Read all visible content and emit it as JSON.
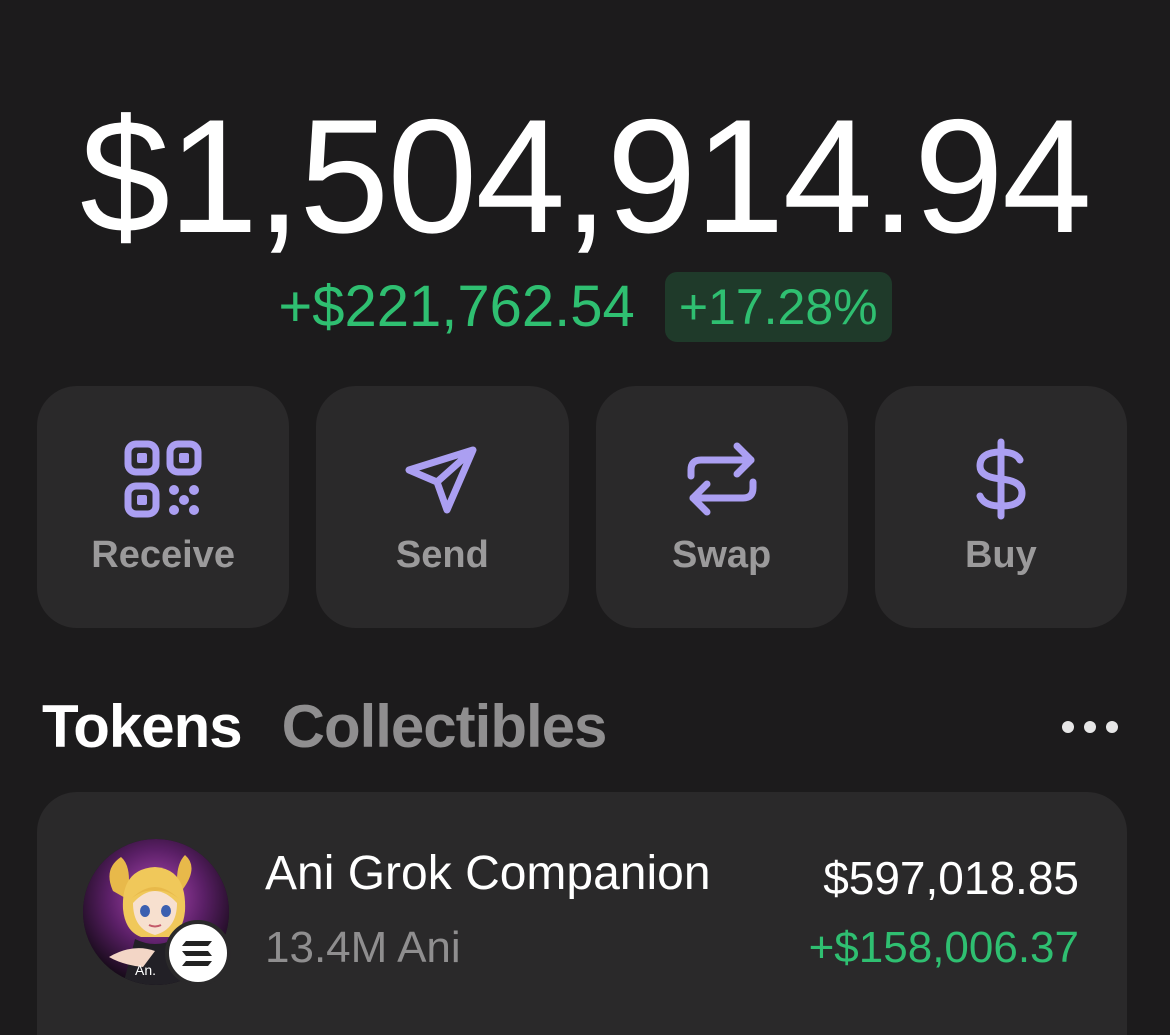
{
  "balance": {
    "total": "$1,504,914.94",
    "change_amount": "+$221,762.54",
    "change_percent": "+17.28%"
  },
  "actions": [
    {
      "label": "Receive",
      "icon": "qr-code-icon"
    },
    {
      "label": "Send",
      "icon": "send-icon"
    },
    {
      "label": "Swap",
      "icon": "swap-icon"
    },
    {
      "label": "Buy",
      "icon": "dollar-icon"
    }
  ],
  "tabs": {
    "active": "Tokens",
    "inactive": "Collectibles",
    "more_icon": "more-icon"
  },
  "tokens": [
    {
      "name": "Ani Grok Companion",
      "amount": "13.4M Ani",
      "value": "$597,018.85",
      "change": "+$158,006.37",
      "avatar_label": "An.",
      "chain_icon": "solana-icon"
    }
  ],
  "colors": {
    "background": "#1c1b1c",
    "card": "#2a292a",
    "accent": "#ab9ff2",
    "positive": "#2fbf71",
    "muted": "#8f8e8f"
  }
}
